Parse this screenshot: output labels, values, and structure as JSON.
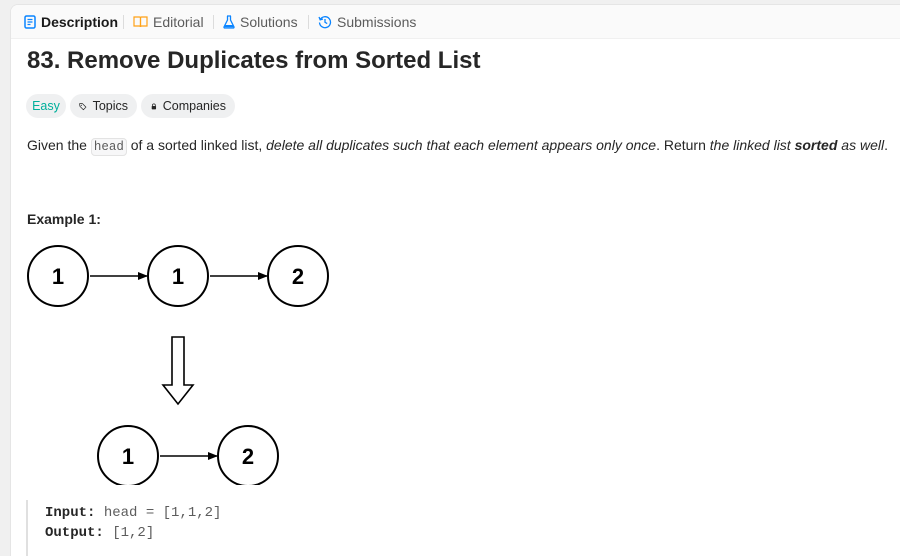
{
  "tabs": [
    {
      "label": "Description",
      "icon": "description-icon",
      "active": true
    },
    {
      "label": "Editorial",
      "icon": "book-icon",
      "active": false
    },
    {
      "label": "Solutions",
      "icon": "flask-icon",
      "active": false
    },
    {
      "label": "Submissions",
      "icon": "history-icon",
      "active": false
    }
  ],
  "problem": {
    "title": "83. Remove Duplicates from Sorted List",
    "difficulty": "Easy",
    "topics_label": "Topics",
    "companies_label": "Companies"
  },
  "description": {
    "part1": "Given the ",
    "code": "head",
    "part2": " of a sorted linked list, ",
    "italic1": "delete all duplicates such that each element appears only once",
    "part3": ". Return ",
    "italic2": "the linked list ",
    "bold": "sorted",
    "italic3": " as well",
    "part4": "."
  },
  "example": {
    "title": "Example 1:",
    "input_nodes": [
      "1",
      "1",
      "2"
    ],
    "output_nodes": [
      "1",
      "2"
    ],
    "input_label": "Input:",
    "input_value": "head = [1,1,2]",
    "output_label": "Output:",
    "output_value": "[1,2]"
  },
  "colors": {
    "easy": "#00af9b",
    "editorial_icon": "#ffa116",
    "solutions_icon": "#0a84ff",
    "submissions_icon": "#0a84ff",
    "description_icon": "#0a84ff"
  }
}
